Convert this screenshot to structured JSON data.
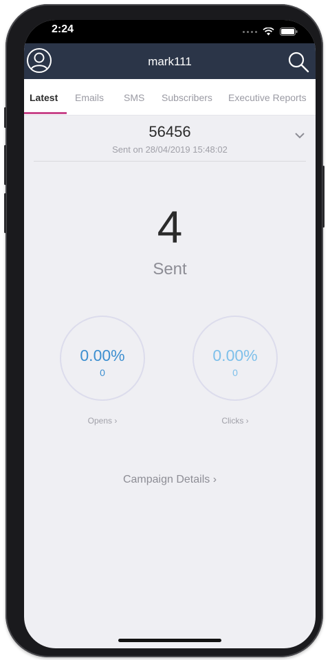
{
  "status_bar": {
    "time": "2:24"
  },
  "header": {
    "title": "mark111",
    "avatar_icon": "user-avatar-icon",
    "search_icon": "search-icon"
  },
  "tabs": [
    {
      "label": "Latest",
      "active": true
    },
    {
      "label": "Emails",
      "active": false
    },
    {
      "label": "SMS",
      "active": false
    },
    {
      "label": "Subscribers",
      "active": false
    },
    {
      "label": "Executive Reports",
      "active": false
    }
  ],
  "campaign": {
    "name": "56456",
    "sent_on": "Sent on 28/04/2019 15:48:02"
  },
  "summary": {
    "sent_count": "4",
    "sent_label": "Sent"
  },
  "metrics": {
    "opens": {
      "percent": "0.00%",
      "count": "0",
      "label": "Opens ›",
      "color": "#3d8fd0"
    },
    "clicks": {
      "percent": "0.00%",
      "count": "0",
      "label": "Clicks ›",
      "color": "#7ec0ea"
    }
  },
  "campaign_details_label": "Campaign Details ›",
  "colors": {
    "header_bg": "#2b3548",
    "tab_accent": "#c8458a",
    "page_bg": "#efeff3"
  }
}
